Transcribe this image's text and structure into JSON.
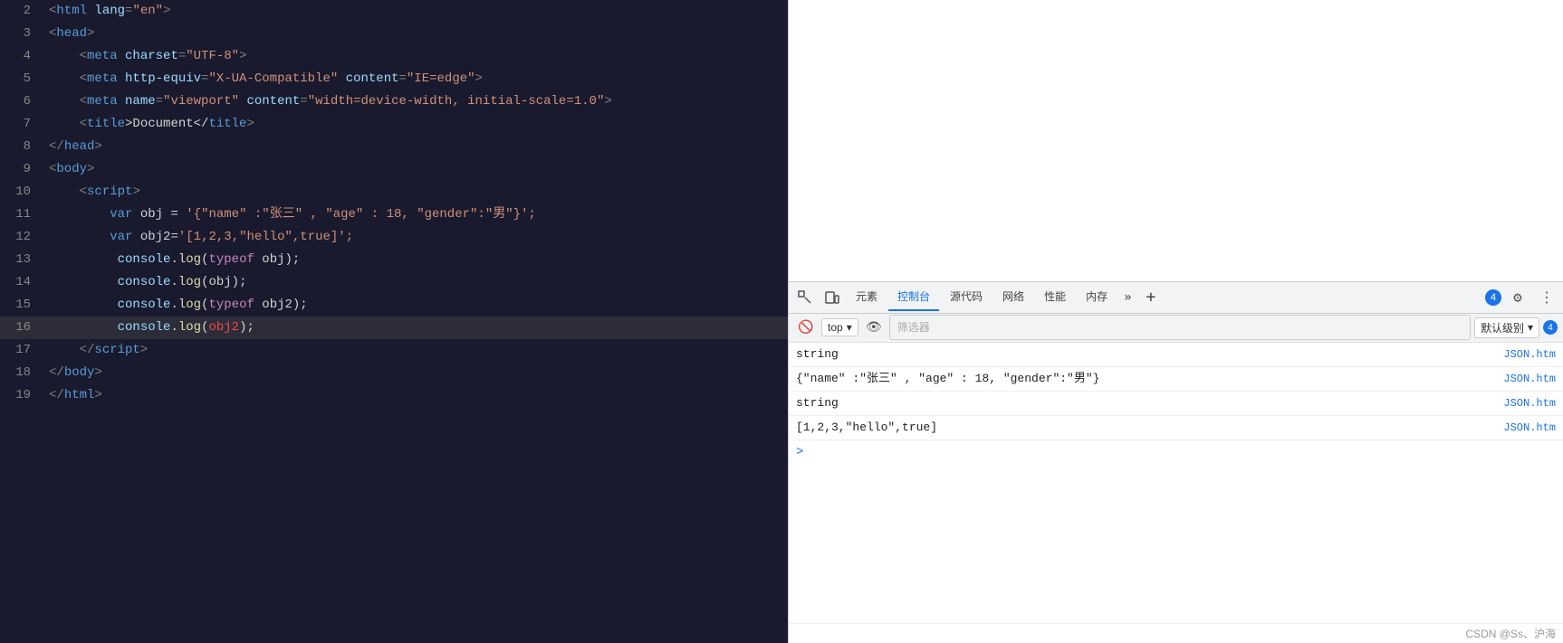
{
  "editor": {
    "lines": [
      {
        "num": 2,
        "tokens": [
          {
            "t": "<",
            "c": "tag-bracket"
          },
          {
            "t": "html",
            "c": "tag"
          },
          {
            "t": " ",
            "c": "plain"
          },
          {
            "t": "lang",
            "c": "attr"
          },
          {
            "t": "=",
            "c": "punc"
          },
          {
            "t": "\"en\"",
            "c": "val"
          },
          {
            "t": ">",
            "c": "tag-bracket"
          }
        ]
      },
      {
        "num": 3,
        "tokens": [
          {
            "t": "<",
            "c": "tag-bracket"
          },
          {
            "t": "head",
            "c": "tag"
          },
          {
            "t": ">",
            "c": "tag-bracket"
          }
        ]
      },
      {
        "num": 4,
        "tokens": [
          {
            "t": "    <",
            "c": "tag-bracket"
          },
          {
            "t": "meta",
            "c": "tag"
          },
          {
            "t": " ",
            "c": "plain"
          },
          {
            "t": "charset",
            "c": "attr"
          },
          {
            "t": "=",
            "c": "punc"
          },
          {
            "t": "\"UTF-8\"",
            "c": "val"
          },
          {
            "t": ">",
            "c": "tag-bracket"
          }
        ]
      },
      {
        "num": 5,
        "tokens": [
          {
            "t": "    <",
            "c": "tag-bracket"
          },
          {
            "t": "meta",
            "c": "tag"
          },
          {
            "t": " ",
            "c": "plain"
          },
          {
            "t": "http-equiv",
            "c": "attr"
          },
          {
            "t": "=",
            "c": "punc"
          },
          {
            "t": "\"X-UA-Compatible\"",
            "c": "val"
          },
          {
            "t": " ",
            "c": "plain"
          },
          {
            "t": "content",
            "c": "attr"
          },
          {
            "t": "=",
            "c": "punc"
          },
          {
            "t": "\"IE=edge\"",
            "c": "val"
          },
          {
            "t": ">",
            "c": "tag-bracket"
          }
        ]
      },
      {
        "num": 6,
        "tokens": [
          {
            "t": "    <",
            "c": "tag-bracket"
          },
          {
            "t": "meta",
            "c": "tag"
          },
          {
            "t": " ",
            "c": "plain"
          },
          {
            "t": "name",
            "c": "attr"
          },
          {
            "t": "=",
            "c": "punc"
          },
          {
            "t": "\"viewport\"",
            "c": "val"
          },
          {
            "t": " ",
            "c": "plain"
          },
          {
            "t": "content",
            "c": "attr"
          },
          {
            "t": "=",
            "c": "punc"
          },
          {
            "t": "\"width=device-width, initial-scale=1.0\"",
            "c": "val"
          },
          {
            "t": ">",
            "c": "tag-bracket"
          }
        ]
      },
      {
        "num": 7,
        "tokens": [
          {
            "t": "    <",
            "c": "tag-bracket"
          },
          {
            "t": "title",
            "c": "tag"
          },
          {
            "t": ">Document</",
            "c": "plain"
          },
          {
            "t": "title",
            "c": "tag"
          },
          {
            "t": ">",
            "c": "tag-bracket"
          }
        ]
      },
      {
        "num": 8,
        "tokens": [
          {
            "t": "</",
            "c": "tag-bracket"
          },
          {
            "t": "head",
            "c": "tag"
          },
          {
            "t": ">",
            "c": "tag-bracket"
          }
        ]
      },
      {
        "num": 9,
        "tokens": [
          {
            "t": "<",
            "c": "tag-bracket"
          },
          {
            "t": "body",
            "c": "tag"
          },
          {
            "t": ">",
            "c": "tag-bracket"
          }
        ]
      },
      {
        "num": 10,
        "tokens": [
          {
            "t": "    <",
            "c": "tag-bracket"
          },
          {
            "t": "script",
            "c": "tag"
          },
          {
            "t": ">",
            "c": "tag-bracket"
          }
        ]
      },
      {
        "num": 11,
        "tokens": [
          {
            "t": "        ",
            "c": "plain"
          },
          {
            "t": "var",
            "c": "var-kw"
          },
          {
            "t": " obj = ",
            "c": "plain"
          },
          {
            "t": "'",
            "c": "str"
          },
          {
            "t": "{",
            "c": "str"
          },
          {
            "t": "\"name\"",
            "c": "str"
          },
          {
            "t": " :",
            "c": "str"
          },
          {
            "t": "\"张三\"",
            "c": "str"
          },
          {
            "t": " , ",
            "c": "str"
          },
          {
            "t": "\"age\"",
            "c": "str"
          },
          {
            "t": " : ",
            "c": "str"
          },
          {
            "t": "18",
            "c": "str"
          },
          {
            "t": ", ",
            "c": "str"
          },
          {
            "t": "\"gender\"",
            "c": "str"
          },
          {
            "t": ":",
            "c": "str"
          },
          {
            "t": "\"男\"",
            "c": "str"
          },
          {
            "t": "}",
            "c": "str"
          },
          {
            "t": "';",
            "c": "str"
          }
        ]
      },
      {
        "num": 12,
        "tokens": [
          {
            "t": "        ",
            "c": "plain"
          },
          {
            "t": "var",
            "c": "var-kw"
          },
          {
            "t": " obj2=",
            "c": "plain"
          },
          {
            "t": "'[1,2,3,",
            "c": "str"
          },
          {
            "t": "\"hello\"",
            "c": "str"
          },
          {
            "t": ",true]';",
            "c": "str"
          }
        ]
      },
      {
        "num": 13,
        "tokens": [
          {
            "t": "         ",
            "c": "plain"
          },
          {
            "t": "console",
            "c": "var-name"
          },
          {
            "t": ".",
            "c": "plain"
          },
          {
            "t": "log",
            "c": "fn"
          },
          {
            "t": "(",
            "c": "plain"
          },
          {
            "t": "typeof",
            "c": "kw"
          },
          {
            "t": " obj);",
            "c": "plain"
          }
        ]
      },
      {
        "num": 14,
        "tokens": [
          {
            "t": "         ",
            "c": "plain"
          },
          {
            "t": "console",
            "c": "var-name"
          },
          {
            "t": ".",
            "c": "plain"
          },
          {
            "t": "log",
            "c": "fn"
          },
          {
            "t": "(obj);",
            "c": "plain"
          }
        ]
      },
      {
        "num": 15,
        "tokens": [
          {
            "t": "         ",
            "c": "plain"
          },
          {
            "t": "console",
            "c": "var-name"
          },
          {
            "t": ".",
            "c": "plain"
          },
          {
            "t": "log",
            "c": "fn"
          },
          {
            "t": "(",
            "c": "plain"
          },
          {
            "t": "typeof",
            "c": "kw"
          },
          {
            "t": " obj2);",
            "c": "plain"
          }
        ]
      },
      {
        "num": 16,
        "tokens": [
          {
            "t": "         ",
            "c": "plain"
          },
          {
            "t": "console",
            "c": "var-name"
          },
          {
            "t": ".",
            "c": "plain"
          },
          {
            "t": "log",
            "c": "fn"
          },
          {
            "t": "(",
            "c": "plain"
          },
          {
            "t": "obj2",
            "c": "obj2-highlight"
          },
          {
            "t": ");",
            "c": "plain"
          }
        ],
        "highlighted": true
      },
      {
        "num": 17,
        "tokens": [
          {
            "t": "    </",
            "c": "tag-bracket"
          },
          {
            "t": "script",
            "c": "tag"
          },
          {
            "t": ">",
            "c": "tag-bracket"
          }
        ]
      },
      {
        "num": 18,
        "tokens": [
          {
            "t": "</",
            "c": "tag-bracket"
          },
          {
            "t": "body",
            "c": "tag"
          },
          {
            "t": ">",
            "c": "tag-bracket"
          }
        ]
      },
      {
        "num": 19,
        "tokens": [
          {
            "t": "</",
            "c": "tag-bracket"
          },
          {
            "t": "html",
            "c": "tag"
          },
          {
            "t": ">",
            "c": "tag-bracket"
          }
        ]
      }
    ]
  },
  "devtools": {
    "tabs": [
      {
        "label": "元素",
        "active": false
      },
      {
        "label": "控制台",
        "active": true
      },
      {
        "label": "源代码",
        "active": false
      },
      {
        "label": "网络",
        "active": false
      },
      {
        "label": "性能",
        "active": false
      },
      {
        "label": "内存",
        "active": false
      }
    ],
    "badge_count": "4",
    "toolbar": {
      "top_label": "top",
      "filter_placeholder": "筛选器",
      "level_label": "默认级别",
      "level_badge": "4"
    },
    "console_rows": [
      {
        "text": "string",
        "link": "JSON.htm",
        "type": "output"
      },
      {
        "text": "{\"name\" :\"张三\" , \"age\" : 18, \"gender\":\"男\"}",
        "link": "JSON.htm",
        "type": "output"
      },
      {
        "text": "string",
        "link": "JSON.htm",
        "type": "output"
      },
      {
        "text": "[1,2,3,\"hello\",true]",
        "link": "JSON.htm",
        "type": "output"
      },
      {
        "text": "",
        "link": "",
        "type": "prompt"
      }
    ],
    "watermark": "CSDN @Ss、沪海"
  }
}
